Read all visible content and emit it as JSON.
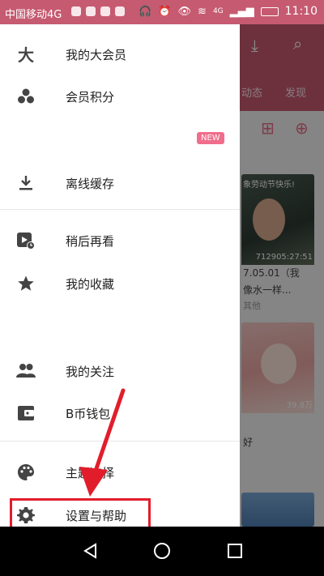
{
  "status_bar": {
    "carrier": "中国移动4G",
    "network": "4G",
    "time": "11:10"
  },
  "drawer": {
    "items": [
      {
        "label": "我的大会员",
        "icon": "da-vip-icon"
      },
      {
        "label": "会员积分",
        "icon": "points-triangle-icon"
      },
      {
        "label": "离线缓存",
        "icon": "download-icon"
      },
      {
        "label": "稍后再看",
        "icon": "watch-later-icon"
      },
      {
        "label": "我的收藏",
        "icon": "star-icon"
      },
      {
        "label": "我的关注",
        "icon": "people-icon"
      },
      {
        "label": "B币钱包",
        "icon": "wallet-icon"
      },
      {
        "label": "主题选择",
        "icon": "palette-icon"
      },
      {
        "label": "设置与帮助",
        "icon": "gear-icon"
      }
    ],
    "new_badge": "NEW"
  },
  "background": {
    "tabs": [
      "动态",
      "发现"
    ],
    "cards": [
      {
        "title_top": "象劳动节快乐!",
        "meta": "712905:27:51",
        "caption": "7.05.01（我",
        "caption2": "像水一样...",
        "sub": "其他"
      },
      {
        "meta": "39.8万",
        "caption": "好"
      }
    ]
  },
  "colors": {
    "accent": "#c65a71",
    "highlight": "#e21d2b",
    "badge": "#f06d8c"
  }
}
